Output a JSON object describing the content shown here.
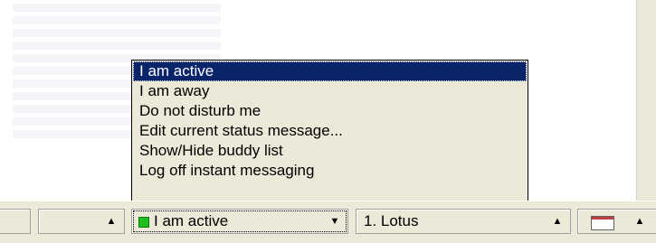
{
  "status_menu": {
    "items": [
      {
        "label": "I am active",
        "selected": true
      },
      {
        "label": "I am away",
        "selected": false
      },
      {
        "label": "Do not disturb me",
        "selected": false
      },
      {
        "label": "Edit current status message...",
        "selected": false
      },
      {
        "label": "Show/Hide buddy list",
        "selected": false
      },
      {
        "label": "Log off instant messaging",
        "selected": false
      }
    ]
  },
  "statusbar": {
    "status_combo": {
      "value": "I am active",
      "dot_color": "#1fbf1f",
      "arrow": "▼"
    },
    "location_combo": {
      "value": "1. Lotus",
      "arrow": "▲"
    },
    "blank_combo": {
      "arrow": "▲"
    },
    "calendar_combo": {
      "icon": "calendar-icon",
      "arrow": "▲"
    }
  }
}
